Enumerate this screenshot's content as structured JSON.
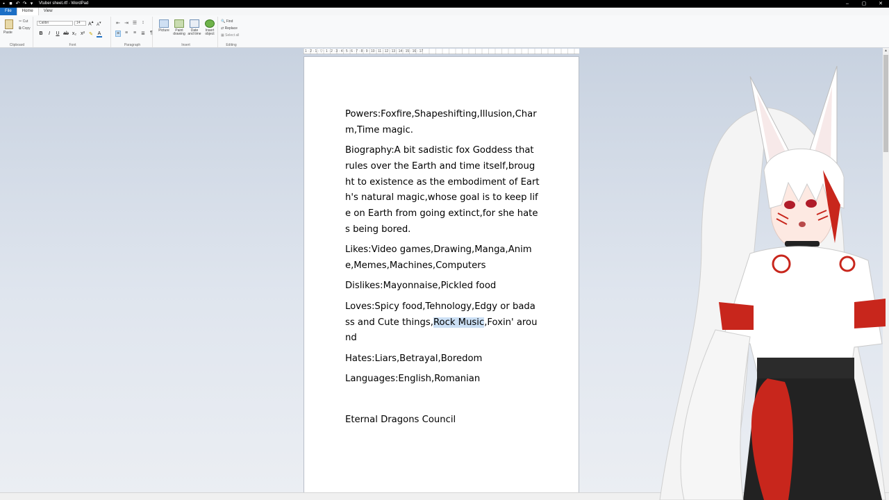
{
  "window": {
    "title": "Vtuber sheet.rtf - WordPad",
    "controls": {
      "minimize": "–",
      "maximize": "▢",
      "close": "✕"
    }
  },
  "tabs": [
    {
      "label": "File"
    },
    {
      "label": "Home"
    },
    {
      "label": "View"
    }
  ],
  "ribbon": {
    "clipboard": {
      "label": "Clipboard",
      "paste": "Paste",
      "cut": "Cut",
      "copy": "Copy"
    },
    "font": {
      "label": "Font",
      "family": "Calibri",
      "size": "14"
    },
    "paragraph": {
      "label": "Paragraph"
    },
    "insert": {
      "label": "Insert",
      "picture": "Picture",
      "paint": "Paint drawing",
      "datetime": "Date and time",
      "object": "Insert object"
    },
    "editing": {
      "label": "Editing",
      "find": "Find",
      "replace": "Replace",
      "select_all": "Select all"
    }
  },
  "ruler": {
    "text": "1 · 2 · 1 · ▽ · 1 · 2 · 3 · 4 · 5 · 6 · 7 · 8 · 9 · 10 · 11 · 12 · 13 · 14 · 15 · 16 · 17"
  },
  "document": {
    "powers": "Powers:Foxfire,Shapeshifting,Illusion,Charm,Time magic.",
    "biography": "Biography:A bit sadistic fox Goddess that rules over the Earth and time itself,brought to existence as the embodiment of Earth's natural magic,whose goal is to keep life on Earth from going extinct,for she hates being bored.",
    "likes": "Likes:Video games,Drawing,Manga,Anime,Memes,Machines,Computers",
    "dislikes": "Dislikes:Mayonnaise,Pickled food",
    "loves_before": "Loves:Spicy food,Tehnology,Edgy or badass and Cute things,",
    "loves_selected": "Rock Music",
    "loves_after": ",Foxin' around",
    "hates": "Hates:Liars,Betrayal,Boredom",
    "languages": "Languages:English,Romanian",
    "footer": "Eternal Dragons Council"
  },
  "colors": {
    "file_tab": "#1c6fc5",
    "selection": "#cce0f5",
    "avatar_red": "#c8261c",
    "avatar_white": "#ffffff"
  }
}
